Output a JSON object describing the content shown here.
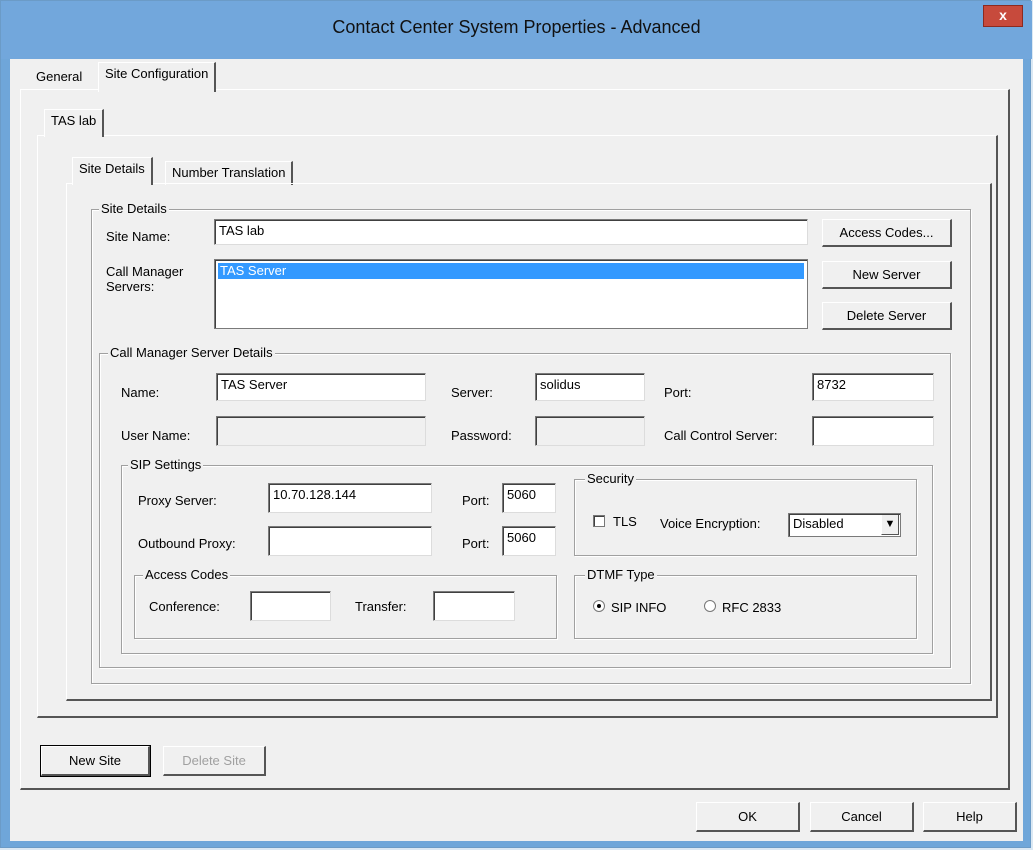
{
  "window": {
    "title": "Contact Center System Properties - Advanced",
    "close_label": "x"
  },
  "tabs_main": [
    "General",
    "Site Configuration"
  ],
  "tabs_site": [
    "TAS lab"
  ],
  "tabs_detail": [
    "Site Details",
    "Number Translation"
  ],
  "site_details": {
    "legend": "Site Details",
    "site_name_label": "Site Name:",
    "site_name_value": "TAS lab",
    "call_manager_label_1": "Call Manager",
    "call_manager_label_2": "Servers:",
    "servers": [
      "TAS Server"
    ],
    "access_codes_btn": "Access Codes...",
    "new_server_btn": "New Server",
    "delete_server_btn": "Delete Server"
  },
  "server_details": {
    "legend": "Call Manager Server Details",
    "name_label": "Name:",
    "name_value": "TAS Server",
    "server_label": "Server:",
    "server_value": "solidus",
    "port_label": "Port:",
    "port_value": "8732",
    "user_label": "User Name:",
    "user_value": "",
    "password_label": "Password:",
    "password_value": "",
    "ccs_label": "Call Control Server:",
    "ccs_value": ""
  },
  "sip": {
    "legend": "SIP Settings",
    "proxy_label": "Proxy Server:",
    "proxy_value": "10.70.128.144",
    "proxy_port_label": "Port:",
    "proxy_port_value": "5060",
    "outbound_label": "Outbound Proxy:",
    "outbound_value": "",
    "outbound_port_label": "Port:",
    "outbound_port_value": "5060"
  },
  "security": {
    "legend": "Security",
    "tls_label": "TLS",
    "voice_label": "Voice Encryption:",
    "voice_value": "Disabled"
  },
  "access_codes": {
    "legend": "Access Codes",
    "conference_label": "Conference:",
    "conference_value": "",
    "transfer_label": "Transfer:",
    "transfer_value": ""
  },
  "dtmf": {
    "legend": "DTMF Type",
    "option1": "SIP INFO",
    "option2": "RFC 2833"
  },
  "site_buttons": {
    "new_site": "New Site",
    "delete_site": "Delete Site"
  },
  "dialog_buttons": {
    "ok": "OK",
    "cancel": "Cancel",
    "help": "Help"
  }
}
